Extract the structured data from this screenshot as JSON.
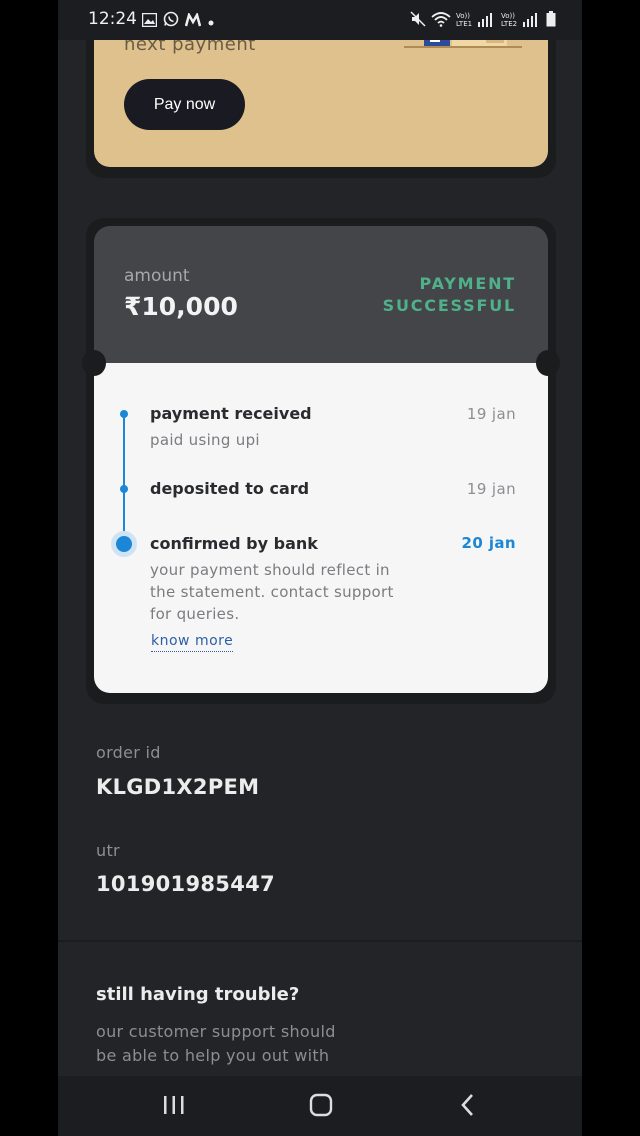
{
  "status_bar": {
    "time": "12:24",
    "left_icons": [
      "gallery-icon",
      "whatsapp-icon",
      "m-app-icon",
      "dot-icon"
    ],
    "right_icons": [
      "mute-icon",
      "wifi-icon",
      "signal-lte1-icon",
      "signal-lte2-icon",
      "battery-icon"
    ]
  },
  "payment_card": {
    "next_payment_label": "next payment",
    "pay_now_label": "Pay now"
  },
  "status_card": {
    "amount_label": "amount",
    "amount_value": "₹10,000",
    "status_line1": "PAYMENT",
    "status_line2": "SUCCESSFUL",
    "status_color": "#4fb08a",
    "steps": [
      {
        "title": "payment received",
        "subtitle": "paid using upi",
        "date": "19 jan",
        "active": false
      },
      {
        "title": "deposited to card",
        "subtitle": "",
        "date": "19 jan",
        "active": false
      },
      {
        "title": "confirmed by bank",
        "subtitle_lines": [
          "your payment should reflect in",
          "the statement. contact support",
          "for queries."
        ],
        "date": "20 jan",
        "active": true
      }
    ],
    "know_more_label": "know more",
    "timeline_color": "#1b87d6"
  },
  "order": {
    "order_id_label": "order id",
    "order_id_value": "KLGD1X2PEM",
    "utr_label": "utr",
    "utr_value": "101901985447"
  },
  "support": {
    "title": "still having trouble?",
    "text_line1": "our customer support should",
    "text_line2": "be able to help you out with"
  },
  "nav_bar": {
    "buttons": [
      "recent-apps-icon",
      "home-icon",
      "back-icon"
    ]
  }
}
